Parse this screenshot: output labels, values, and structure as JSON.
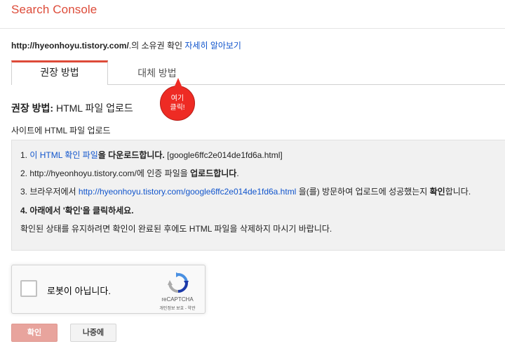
{
  "header": {
    "brand": "Search Console"
  },
  "ownership": {
    "url": "http://hyeonhoyu.tistory.com/",
    "suffix": ".의 소유권 확인 ",
    "learn_more": "자세히 알아보기"
  },
  "tabs": [
    {
      "label": "권장 방법",
      "active": true
    },
    {
      "label": "대체 방법",
      "active": false
    }
  ],
  "callout": {
    "line1": "여기",
    "line2": "클릭!"
  },
  "section": {
    "title_bold": "권장 방법:",
    "title_rest": " HTML 파일 업로드",
    "subtitle": "사이트에 HTML 파일 업로드"
  },
  "steps": {
    "s1_num": "1. ",
    "s1_link": "이 HTML 확인 파일",
    "s1_bold": "을 다운로드합니다.",
    "s1_rest": " [google6ffc2e014de1fd6a.html]",
    "s2_text": "2. http://hyeonhoyu.tistory.com/에 인증 파일을 ",
    "s2_bold": "업로드합니다",
    "s2_end": ".",
    "s3_num": "3. 브라우저에서 ",
    "s3_link": "http://hyeonhoyu.tistory.com/google6ffc2e014de1fd6a.html",
    "s3_mid": " 을(를) 방문하여 업로드에 성공했는지 ",
    "s3_bold": "확인",
    "s3_end": "합니다.",
    "s4_bold": "4. 아래에서 '확인'을 클릭하세요.",
    "note": "확인된 상태를 유지하려면 확인이 완료된 후에도 HTML 파일을 삭제하지 마시기 바랍니다."
  },
  "recaptcha": {
    "label": "로봇이 아닙니다.",
    "brand": "reCAPTCHA",
    "links": "개인정보 보호 - 약관"
  },
  "buttons": {
    "confirm": "확인",
    "later": "나중에"
  },
  "colors": {
    "brand": "#dd4b39",
    "link": "#1155cc",
    "callout": "#ee2b24",
    "confirm_disabled": "#e8a49d"
  }
}
